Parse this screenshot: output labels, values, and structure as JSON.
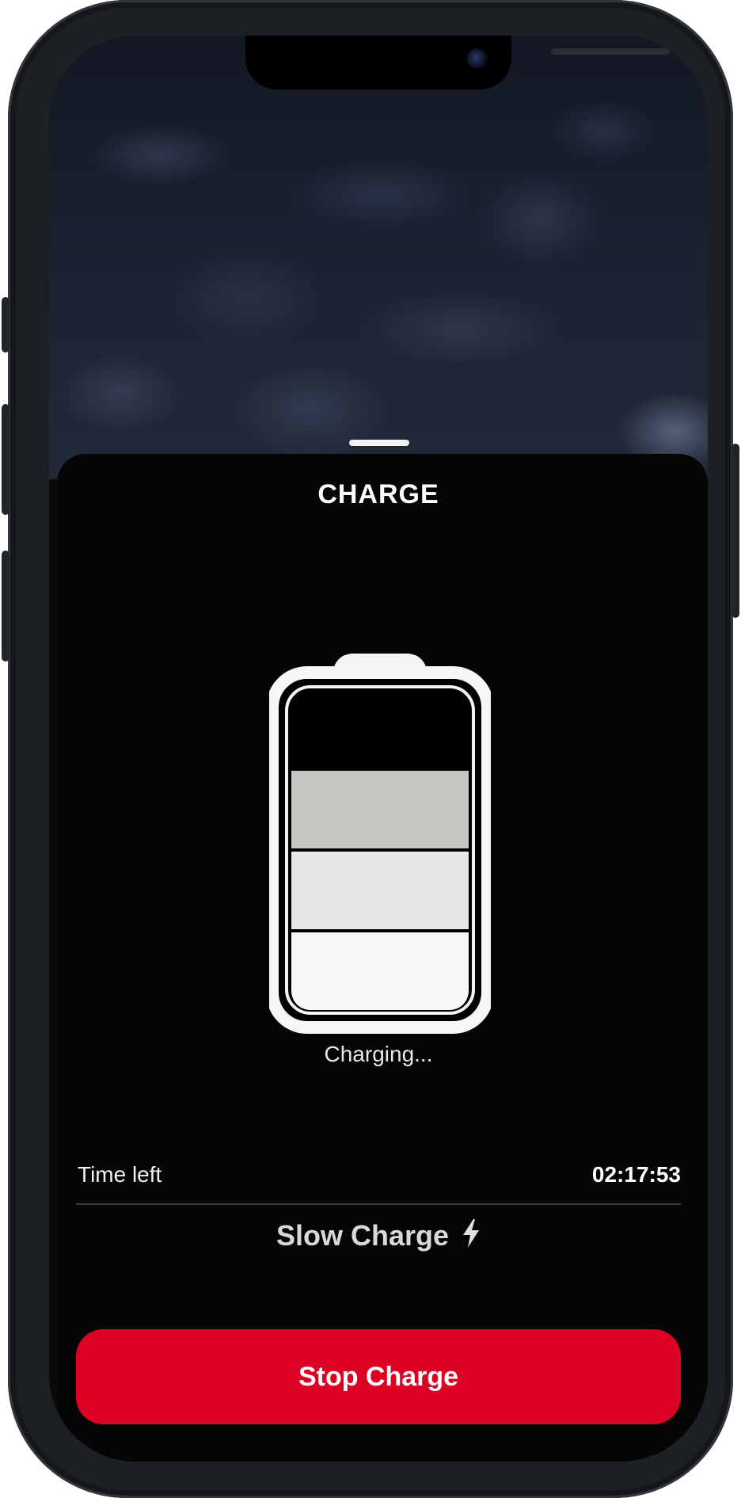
{
  "screen": {
    "title": "CHARGE",
    "status_text": "Charging...",
    "time_left": {
      "label": "Time left",
      "value": "02:17:53"
    },
    "charge_mode": {
      "label": "Slow Charge",
      "icon": "lightning-bolt-icon"
    },
    "primary_action": {
      "label": "Stop Charge"
    }
  },
  "battery": {
    "segments_total": 4,
    "segments_filled": 3,
    "level_fraction": 0.75
  },
  "colors": {
    "accent": "#dc0024",
    "sheet_background": "#050505",
    "battery_segment_1": "#f7f7f9",
    "battery_segment_2": "#e8e7e5",
    "battery_segment_3": "#c6c5c1"
  }
}
